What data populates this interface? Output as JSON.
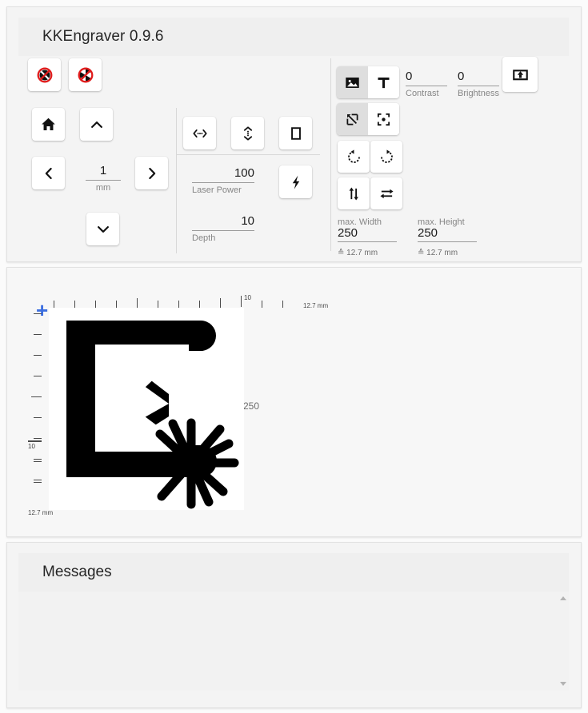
{
  "app": {
    "title": "KKEngraver 0.9.6"
  },
  "connection": {
    "disconnect_label": "no-connection",
    "stop_label": "no-spindle"
  },
  "jog": {
    "home_label": "home",
    "up_label": "up",
    "left_label": "left",
    "right_label": "right",
    "down_label": "down",
    "step_value": "1",
    "step_unit": "mm"
  },
  "move": {
    "horizontal_label": "move-horizontal",
    "vertical_label": "move-vertical",
    "frame_label": "frame"
  },
  "engrave": {
    "laser_power_value": "100",
    "laser_power_label": "Laser Power",
    "depth_value": "10",
    "depth_label": "Depth",
    "start_label": "start-engraving"
  },
  "image_tools": {
    "image_mode_label": "image-mode",
    "text_mode_label": "text-mode",
    "scale_mode_label": "scale-mode",
    "center_mode_label": "center-mode",
    "rotate_left_label": "rotate-left",
    "rotate_right_label": "rotate-right",
    "flip_vertical_label": "flip-vertical",
    "flip_horizontal_label": "flip-horizontal",
    "upload_label": "upload"
  },
  "adjust": {
    "contrast_value": "0",
    "contrast_label": "Contrast",
    "brightness_value": "0",
    "brightness_label": "Brightness"
  },
  "size": {
    "max_width_label": "max. Width",
    "max_width_value": "250",
    "max_width_mm": "≙ 12.7 mm",
    "max_height_label": "max. Height",
    "max_height_value": "250",
    "max_height_mm": "≙ 12.7 mm"
  },
  "canvas": {
    "origin_marker": "+",
    "top_ruler_number": "10",
    "top_ruler_unit": "12.7 mm",
    "left_ruler_number": "10",
    "left_ruler_unit": "12.7 mm",
    "right_dimension": "250",
    "artwork_description": "sigma-with-starburst"
  },
  "messages": {
    "title": "Messages",
    "content": "",
    "scroll_up_label": "scroll-up",
    "scroll_down_label": "scroll-down"
  },
  "colors": {
    "accent": "#3d6fe0",
    "warning": "#e01b1b",
    "panel": "#f4f4f4",
    "button": "#ffffff",
    "active": "#dedede"
  }
}
